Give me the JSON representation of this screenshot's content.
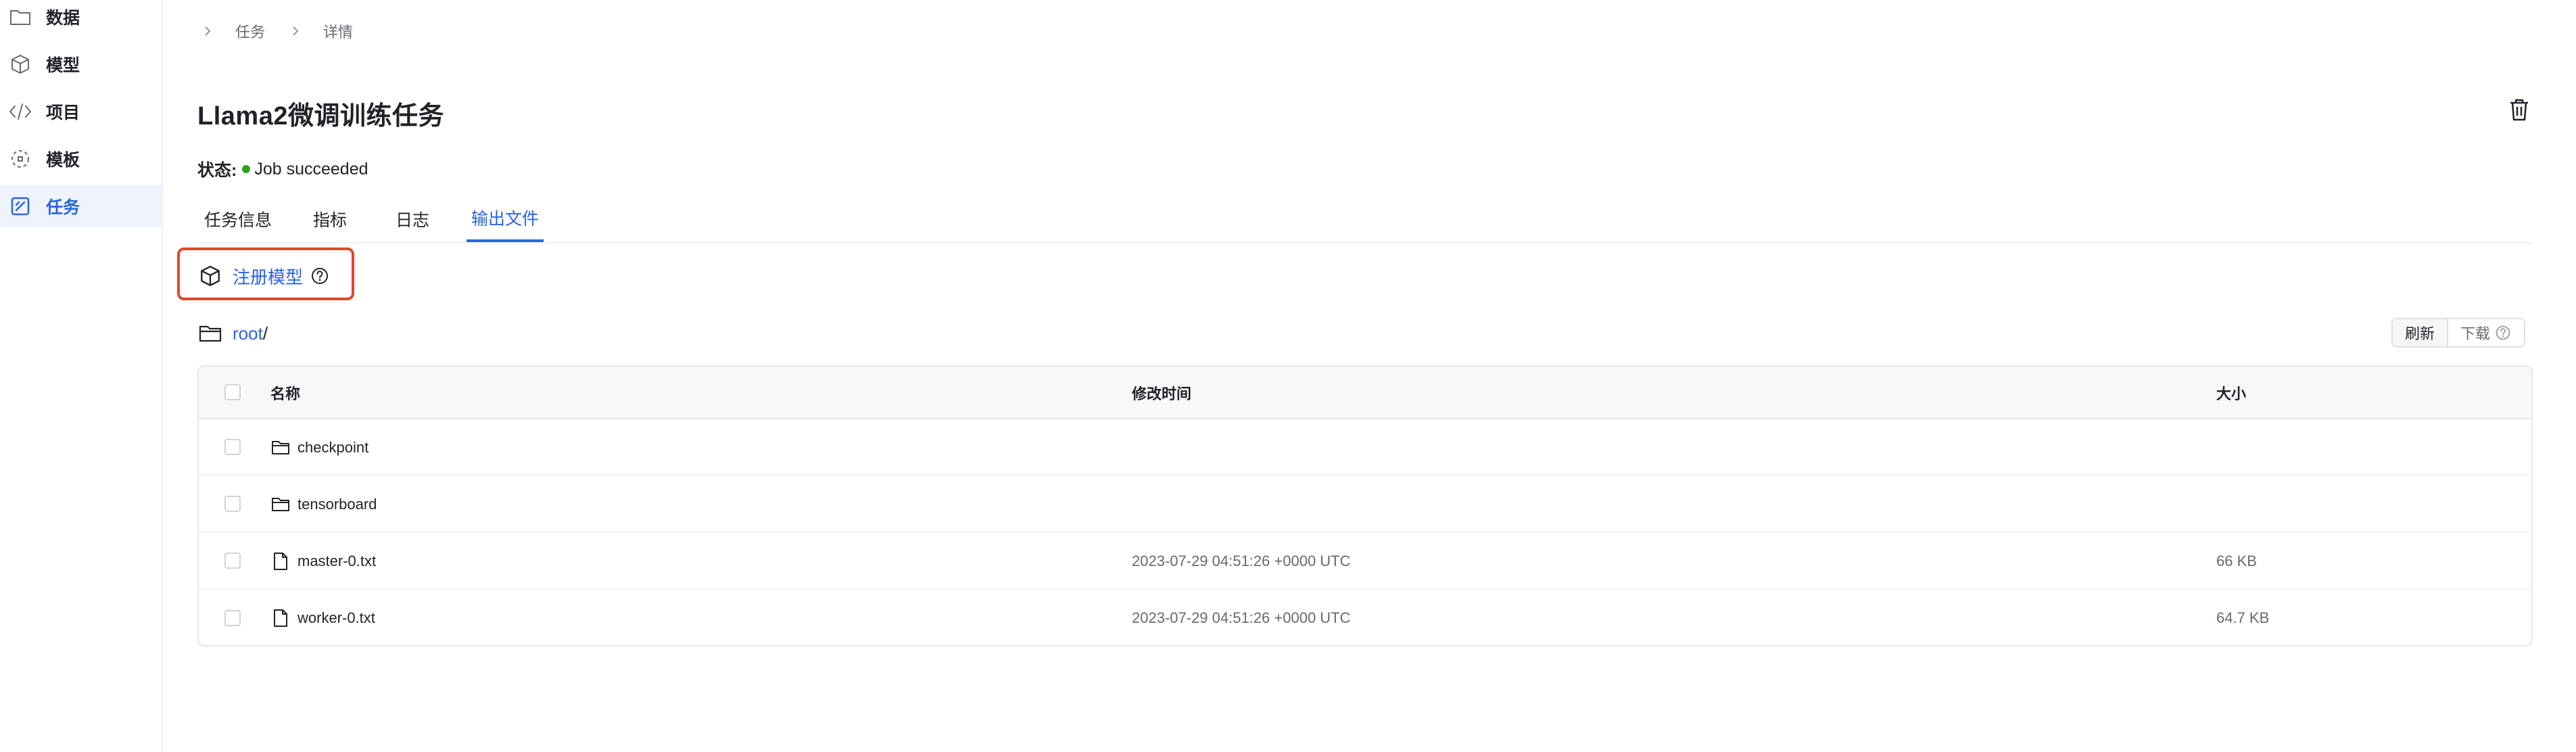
{
  "sidebar": {
    "items": [
      {
        "label": "数据",
        "icon": "folder-icon"
      },
      {
        "label": "模型",
        "icon": "cube-icon"
      },
      {
        "label": "项目",
        "icon": "code-icon"
      },
      {
        "label": "模板",
        "icon": "template-icon"
      },
      {
        "label": "任务",
        "icon": "task-icon",
        "active": true
      }
    ]
  },
  "breadcrumb": [
    "任务",
    "详情"
  ],
  "page": {
    "title": "Llama2微调训练任务",
    "status_label": "状态:",
    "status_value": "Job succeeded",
    "status_color": "#2ea121"
  },
  "tabs": [
    {
      "label": "任务信息"
    },
    {
      "label": "指标"
    },
    {
      "label": "日志"
    },
    {
      "label": "输出文件",
      "active": true
    }
  ],
  "register": {
    "label": "注册模型"
  },
  "path": {
    "root": "root",
    "sep": "/"
  },
  "actions": {
    "refresh": "刷新",
    "download": "下载"
  },
  "table": {
    "columns": [
      "名称",
      "修改时间",
      "大小"
    ],
    "rows": [
      {
        "type": "folder",
        "name": "checkpoint",
        "time": "",
        "size": ""
      },
      {
        "type": "folder",
        "name": "tensorboard",
        "time": "",
        "size": ""
      },
      {
        "type": "file",
        "name": "master-0.txt",
        "time": "2023-07-29 04:51:26 +0000 UTC",
        "size": "66 KB"
      },
      {
        "type": "file",
        "name": "worker-0.txt",
        "time": "2023-07-29 04:51:26 +0000 UTC",
        "size": "64.7 KB"
      }
    ]
  },
  "colors": {
    "accent": "#2a63e2",
    "highlight_border": "#e0482a"
  }
}
